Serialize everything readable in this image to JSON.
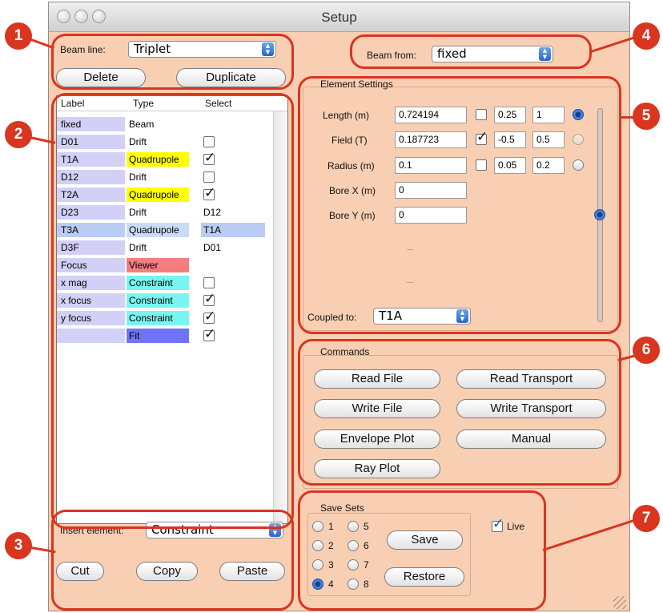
{
  "window": {
    "title": "Setup"
  },
  "panel1": {
    "beam_line_label": "Beam line:",
    "beam_line_value": "Triplet",
    "delete_label": "Delete",
    "duplicate_label": "Duplicate"
  },
  "table": {
    "headers": [
      "Label",
      "Type",
      "Select"
    ],
    "rows": [
      {
        "label": "fixed",
        "type": "Beam",
        "select": "",
        "checkbox": false,
        "checked": false,
        "type_color": "#ffffff"
      },
      {
        "label": "D01",
        "type": "Drift",
        "select": "",
        "checkbox": true,
        "checked": false,
        "type_color": "#ffffff"
      },
      {
        "label": "T1A",
        "type": "Quadrupole",
        "select": "",
        "checkbox": true,
        "checked": true,
        "type_color": "#ffff00"
      },
      {
        "label": "D12",
        "type": "Drift",
        "select": "",
        "checkbox": true,
        "checked": false,
        "type_color": "#ffffff"
      },
      {
        "label": "T2A",
        "type": "Quadrupole",
        "select": "",
        "checkbox": true,
        "checked": true,
        "type_color": "#ffff00"
      },
      {
        "label": "D23",
        "type": "Drift",
        "select": "D12",
        "checkbox": false,
        "checked": false,
        "type_color": "#ffffff"
      },
      {
        "label": "T3A",
        "type": "Quadrupole",
        "select": "T1A",
        "checkbox": false,
        "checked": false,
        "type_color": "#c9dcf7",
        "row_selected": true
      },
      {
        "label": "D3F",
        "type": "Drift",
        "select": "D01",
        "checkbox": false,
        "checked": false,
        "type_color": "#ffffff"
      },
      {
        "label": "Focus",
        "type": "Viewer",
        "select": "",
        "checkbox": false,
        "checked": false,
        "type_color": "#f47d7d"
      },
      {
        "label": "x mag",
        "type": "Constraint",
        "select": "",
        "checkbox": true,
        "checked": false,
        "type_color": "#78f5f0"
      },
      {
        "label": "x focus",
        "type": "Constraint",
        "select": "",
        "checkbox": true,
        "checked": true,
        "type_color": "#78f5f0"
      },
      {
        "label": "y focus",
        "type": "Constraint",
        "select": "",
        "checkbox": true,
        "checked": true,
        "type_color": "#78f5f0"
      },
      {
        "label": "",
        "type": "Fit",
        "select": "",
        "checkbox": true,
        "checked": true,
        "type_color": "#6f73f5"
      }
    ]
  },
  "panel3": {
    "insert_label": "Insert element:",
    "insert_value": "Constraint",
    "cut_label": "Cut",
    "copy_label": "Copy",
    "paste_label": "Paste"
  },
  "panel4": {
    "beam_from_label": "Beam from:",
    "beam_from_value": "fixed"
  },
  "element_settings": {
    "title": "Element Settings",
    "length": {
      "label": "Length (m)",
      "value": "0.724194",
      "checked": false,
      "min": "0.25",
      "max": "1",
      "radio_on": true
    },
    "field": {
      "label": "Field (T)",
      "value": "0.187723",
      "checked": true,
      "min": "-0.5",
      "max": "0.5",
      "radio_on": false
    },
    "radius": {
      "label": "Radius (m)",
      "value": "0.1",
      "checked": false,
      "min": "0.05",
      "max": "0.2",
      "radio_on": false
    },
    "bore_x": {
      "label": "Bore X (m)",
      "value": "0"
    },
    "bore_y": {
      "label": "Bore Y (m)",
      "value": "0"
    },
    "coupled_label": "Coupled to:",
    "coupled_value": "T1A",
    "slider_level": 0.5
  },
  "commands": {
    "title": "Commands",
    "read_file": "Read File",
    "read_transport": "Read Transport",
    "write_file": "Write File",
    "write_transport": "Write Transport",
    "envelope_plot": "Envelope Plot",
    "manual": "Manual",
    "ray_plot": "Ray Plot"
  },
  "save_sets": {
    "title": "Save Sets",
    "options": [
      "1",
      "2",
      "3",
      "4",
      "5",
      "6",
      "7",
      "8"
    ],
    "selected": "4",
    "save_label": "Save",
    "restore_label": "Restore",
    "live_label": "Live",
    "live_checked": true
  },
  "annotations": [
    "1",
    "2",
    "3",
    "4",
    "5",
    "6",
    "7"
  ],
  "colors": {
    "annotation_red": "#d9351f",
    "window_bg": "#f9cfb3"
  }
}
